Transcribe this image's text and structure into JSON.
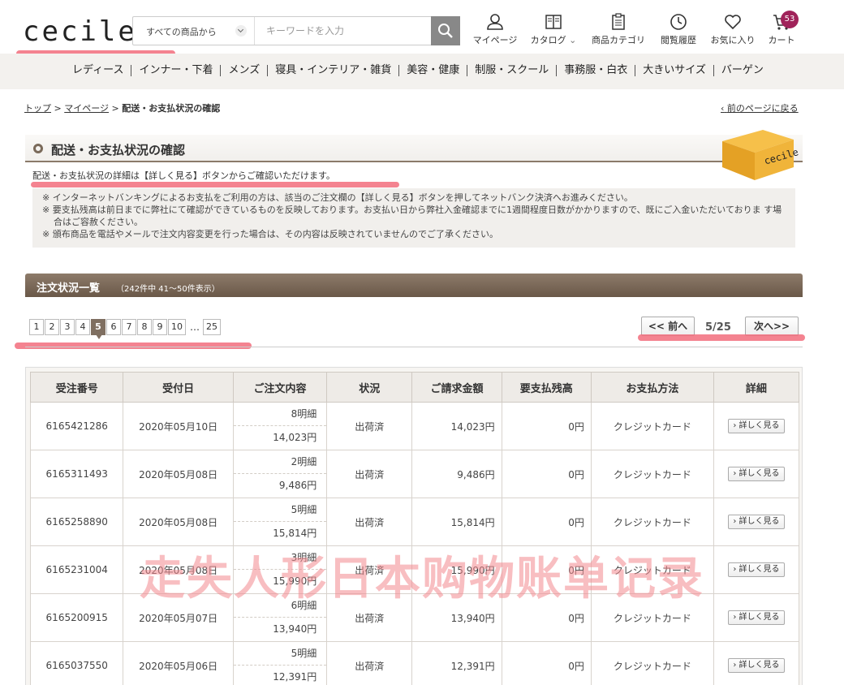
{
  "header": {
    "logo": "cecile",
    "search": {
      "scope": "すべての商品から",
      "placeholder": "キーワードを入力"
    },
    "nav": [
      {
        "label": "マイページ",
        "icon": "person-icon"
      },
      {
        "label": "カタログ",
        "icon": "book-icon"
      },
      {
        "label": "商品カテゴリ",
        "icon": "clipboard-icon"
      },
      {
        "label": "閲覧履歴",
        "icon": "clock-icon"
      },
      {
        "label": "お気に入り",
        "icon": "heart-icon"
      },
      {
        "label": "カート",
        "icon": "cart-icon",
        "badge": "53"
      }
    ]
  },
  "categories": [
    "レディース",
    "インナー・下着",
    "メンズ",
    "寝具・インテリア・雑貨",
    "美容・健康",
    "制服・スクール",
    "事務服・白衣",
    "大きいサイズ",
    "バーゲン"
  ],
  "breadcrumb": {
    "home": "トップ",
    "sep": ">",
    "mypage": "マイページ",
    "current": "配送・お支払状況の確認"
  },
  "back_link": "前のページに戻る",
  "back_mark": "‹",
  "page_title": "配送・お支払状況の確認",
  "box_label": "cecile",
  "intro": "配送・お支払状況の詳細は【詳しく見る】ボタンからご確認いただけます。",
  "notes": [
    "※ インターネットバンキングによるお支払をご利用の方は、該当のご注文欄の【詳しく見る】ボタンを押してネットバンク決済へお進みください。",
    "※ 要支払残高は前日までに弊社にて確認ができているものを反映しております。お支払い日から弊社入金確認までに1週間程度日数がかかりますので、既にご入金いただいておりま す場合はご容赦ください。",
    "※ 頒布商品を電話やメールで注文内容変更を行った場合は、その内容は反映されていませんのでご了承ください。"
  ],
  "list": {
    "title": "注文状況一覧",
    "subtitle": "（242件中 41～50件表示）"
  },
  "pagination": {
    "pages": [
      "1",
      "2",
      "3",
      "4",
      "5",
      "6",
      "7",
      "8",
      "9",
      "10"
    ],
    "current": "5",
    "ellipsis": "…",
    "last": "25",
    "prev_label": "<< 前へ",
    "next_label": "次へ>>",
    "count": "5/25"
  },
  "table": {
    "headers": [
      "受注番号",
      "受付日",
      "ご注文内容",
      "状況",
      "ご請求金額",
      "要支払残高",
      "お支払方法",
      "詳細"
    ],
    "rows": [
      {
        "order_no": "6165421286",
        "date": "2020年05月10日",
        "items": "8明細",
        "item_amount": "14,023円",
        "status": "出荷済",
        "amount": "14,023円",
        "balance": "0円",
        "method": "クレジットカード",
        "detail": "› 詳しく見る"
      },
      {
        "order_no": "6165311493",
        "date": "2020年05月08日",
        "items": "2明細",
        "item_amount": "9,486円",
        "status": "出荷済",
        "amount": "9,486円",
        "balance": "0円",
        "method": "クレジットカード",
        "detail": "› 詳しく見る"
      },
      {
        "order_no": "6165258890",
        "date": "2020年05月08日",
        "items": "5明細",
        "item_amount": "15,814円",
        "status": "出荷済",
        "amount": "15,814円",
        "balance": "0円",
        "method": "クレジットカード",
        "detail": "› 詳しく見る"
      },
      {
        "order_no": "6165231004",
        "date": "2020年05月08日",
        "items": "3明細",
        "item_amount": "15,990円",
        "status": "出荷済",
        "amount": "15,990円",
        "balance": "0円",
        "method": "クレジットカード",
        "detail": "› 詳しく見る"
      },
      {
        "order_no": "6165200915",
        "date": "2020年05月07日",
        "items": "6明細",
        "item_amount": "13,940円",
        "status": "出荷済",
        "amount": "13,940円",
        "balance": "0円",
        "method": "クレジットカード",
        "detail": "› 詳しく見る"
      },
      {
        "order_no": "6165037550",
        "date": "2020年05月06日",
        "items": "5明細",
        "item_amount": "12,391円",
        "status": "出荷済",
        "amount": "12,391円",
        "balance": "0円",
        "method": "クレジットカード",
        "detail": "› 詳しく見る"
      }
    ]
  },
  "watermark": "走失人形日本购物账单记录",
  "colors": {
    "accent": "#a0235a",
    "brown": "#7f6f61",
    "highlight": "#f26d7d"
  }
}
